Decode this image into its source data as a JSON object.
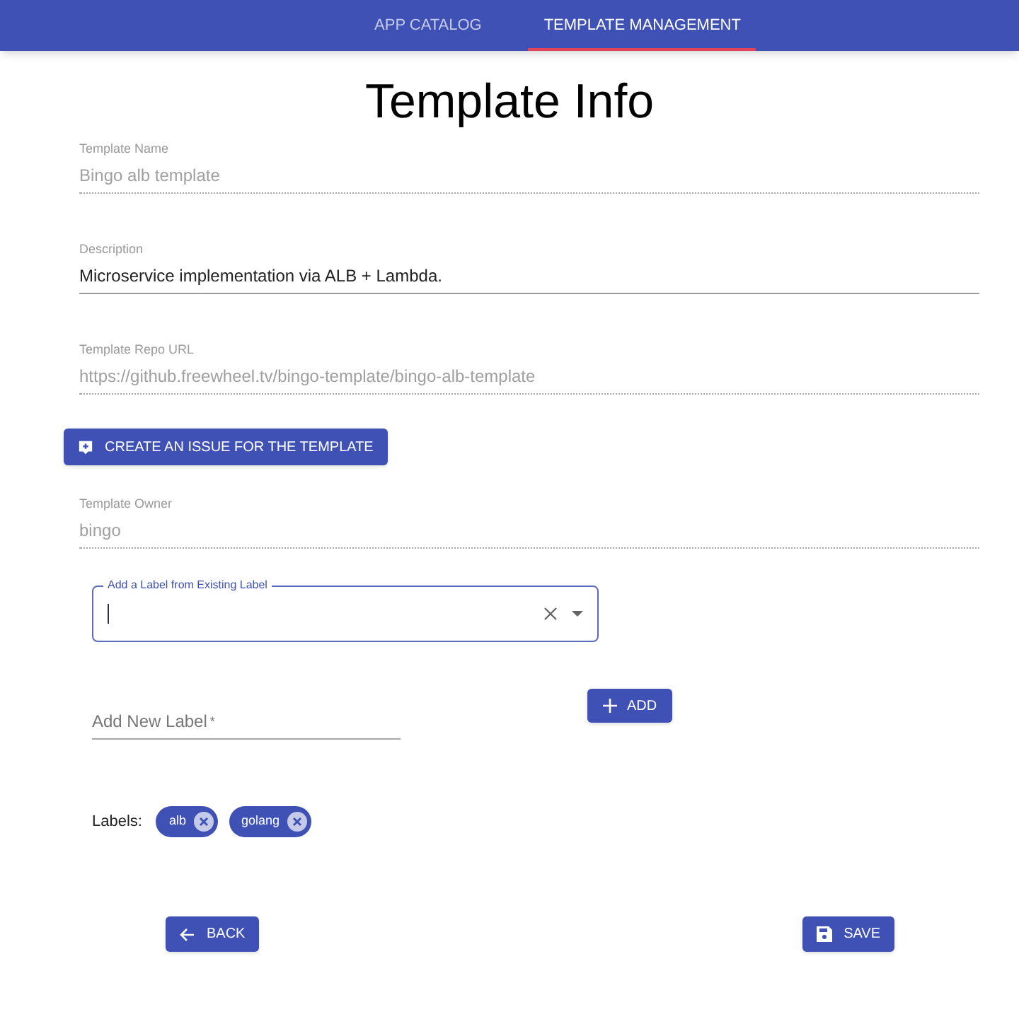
{
  "nav": {
    "tabs": [
      {
        "label": "APP CATALOG",
        "selected": false
      },
      {
        "label": "TEMPLATE MANAGEMENT",
        "selected": true
      }
    ]
  },
  "title": "Template Info",
  "fields": [
    {
      "label": "Template Name",
      "value": "Bingo alb template",
      "disabled": true
    },
    {
      "label": "Description",
      "value": "Microservice implementation via ALB + Lambda.",
      "disabled": false
    },
    {
      "label": "Template Repo URL",
      "value": "https://github.freewheel.tv/bingo-template/bingo-alb-template",
      "disabled": true
    }
  ],
  "issue_button": "CREATE AN ISSUE FOR THE TEMPLATE",
  "owner": {
    "label": "Template Owner",
    "value": "bingo",
    "disabled": true
  },
  "existing_label": {
    "label": "Add a Label from Existing Label"
  },
  "new_label": {
    "placeholder": "Add New Label",
    "required_mark": "*"
  },
  "add_button": "ADD",
  "labels": {
    "caption": "Labels:",
    "chips": [
      "alb",
      "golang"
    ]
  },
  "back_button": "BACK",
  "save_button": "SAVE"
}
